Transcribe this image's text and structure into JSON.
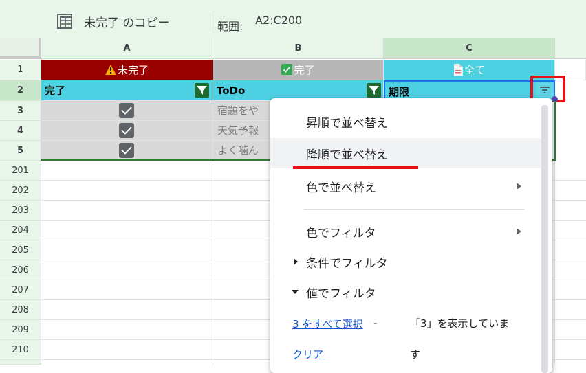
{
  "filter_view": {
    "name": "未完了 のコピー",
    "range_label": "範囲:",
    "range_value": "A2:C200"
  },
  "columns": [
    "A",
    "B",
    "C"
  ],
  "row_numbers": [
    "1",
    "2",
    "3",
    "4",
    "5",
    "201",
    "202",
    "203",
    "204",
    "205",
    "206",
    "207",
    "208",
    "209",
    "210"
  ],
  "row1": {
    "a": "未完了",
    "b": "完了",
    "c": "全て"
  },
  "headers": {
    "a": "完了",
    "b": "ToDo",
    "c": "期限"
  },
  "data_rows": [
    {
      "checked": true,
      "todo": "宿題をや"
    },
    {
      "checked": true,
      "todo": "天気予報"
    },
    {
      "checked": true,
      "todo": "よく噛ん"
    }
  ],
  "menu": {
    "sort_asc": "昇順で並べ替え",
    "sort_desc": "降順で並べ替え",
    "sort_by_color": "色で並べ替え",
    "filter_by_color": "色でフィルタ",
    "filter_by_condition": "条件でフィルタ",
    "filter_by_values": "値でフィルタ",
    "select_all": "3 をすべて選択",
    "dash": "-",
    "clear": "クリア",
    "showing_line1": "「3」を表示していま",
    "showing_line2": "す"
  },
  "icons": {
    "filter_view": "filter-view-icon",
    "warning": "warning-icon",
    "checkbox": "checkbox-icon",
    "document": "document-icon",
    "filter": "filter-icon",
    "submenu": "chevron-right-icon"
  },
  "colors": {
    "row1_a": "#990000",
    "row1_b": "#b7b7b7",
    "row1_c": "#4dd0e1",
    "header": "#4dd0e1",
    "filter_active": "#1e6b30",
    "highlight": "#e3121a",
    "link": "#1155cc"
  }
}
